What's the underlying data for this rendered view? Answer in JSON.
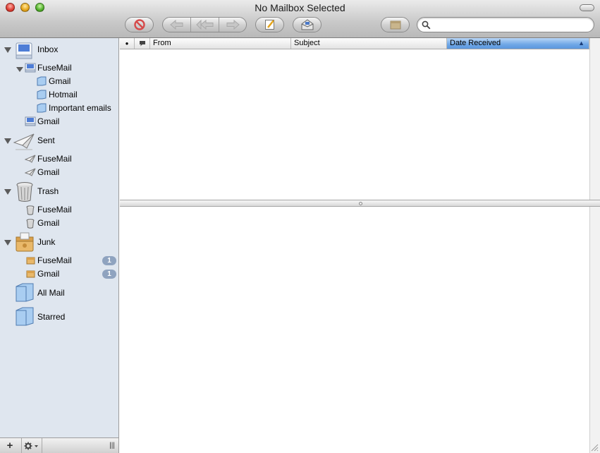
{
  "window": {
    "title": "No Mailbox Selected"
  },
  "toolbar": {
    "buttons": [
      "delete-icon",
      "reply-icon",
      "reply-all-icon",
      "forward-icon",
      "new-message-icon",
      "get-mail-icon",
      "junk-icon"
    ]
  },
  "search": {
    "placeholder": "",
    "value": ""
  },
  "sidebar": {
    "inbox": {
      "label": "Inbox",
      "children": [
        "FuseMail",
        "Gmail",
        "Hotmail",
        "Important emails",
        "Gmail"
      ]
    },
    "sent": {
      "label": "Sent",
      "children": [
        "FuseMail",
        "Gmail"
      ]
    },
    "trash": {
      "label": "Trash",
      "children": [
        "FuseMail",
        "Gmail"
      ]
    },
    "junk": {
      "label": "Junk",
      "children": [
        "FuseMail",
        "Gmail"
      ],
      "badges": [
        "1",
        "1"
      ]
    },
    "all_mail": "All Mail",
    "starred": "Starred",
    "bottom": {
      "add": "+",
      "grip": "|||"
    }
  },
  "message_list": {
    "columns": [
      "●",
      "From",
      "Subject",
      "Date Received"
    ],
    "sort_indicator": "▲",
    "rows": []
  },
  "colors": {
    "sidebar": "#dfe6ef",
    "selected_header": "#6fa7e6",
    "badge": "#8fa3bf"
  }
}
